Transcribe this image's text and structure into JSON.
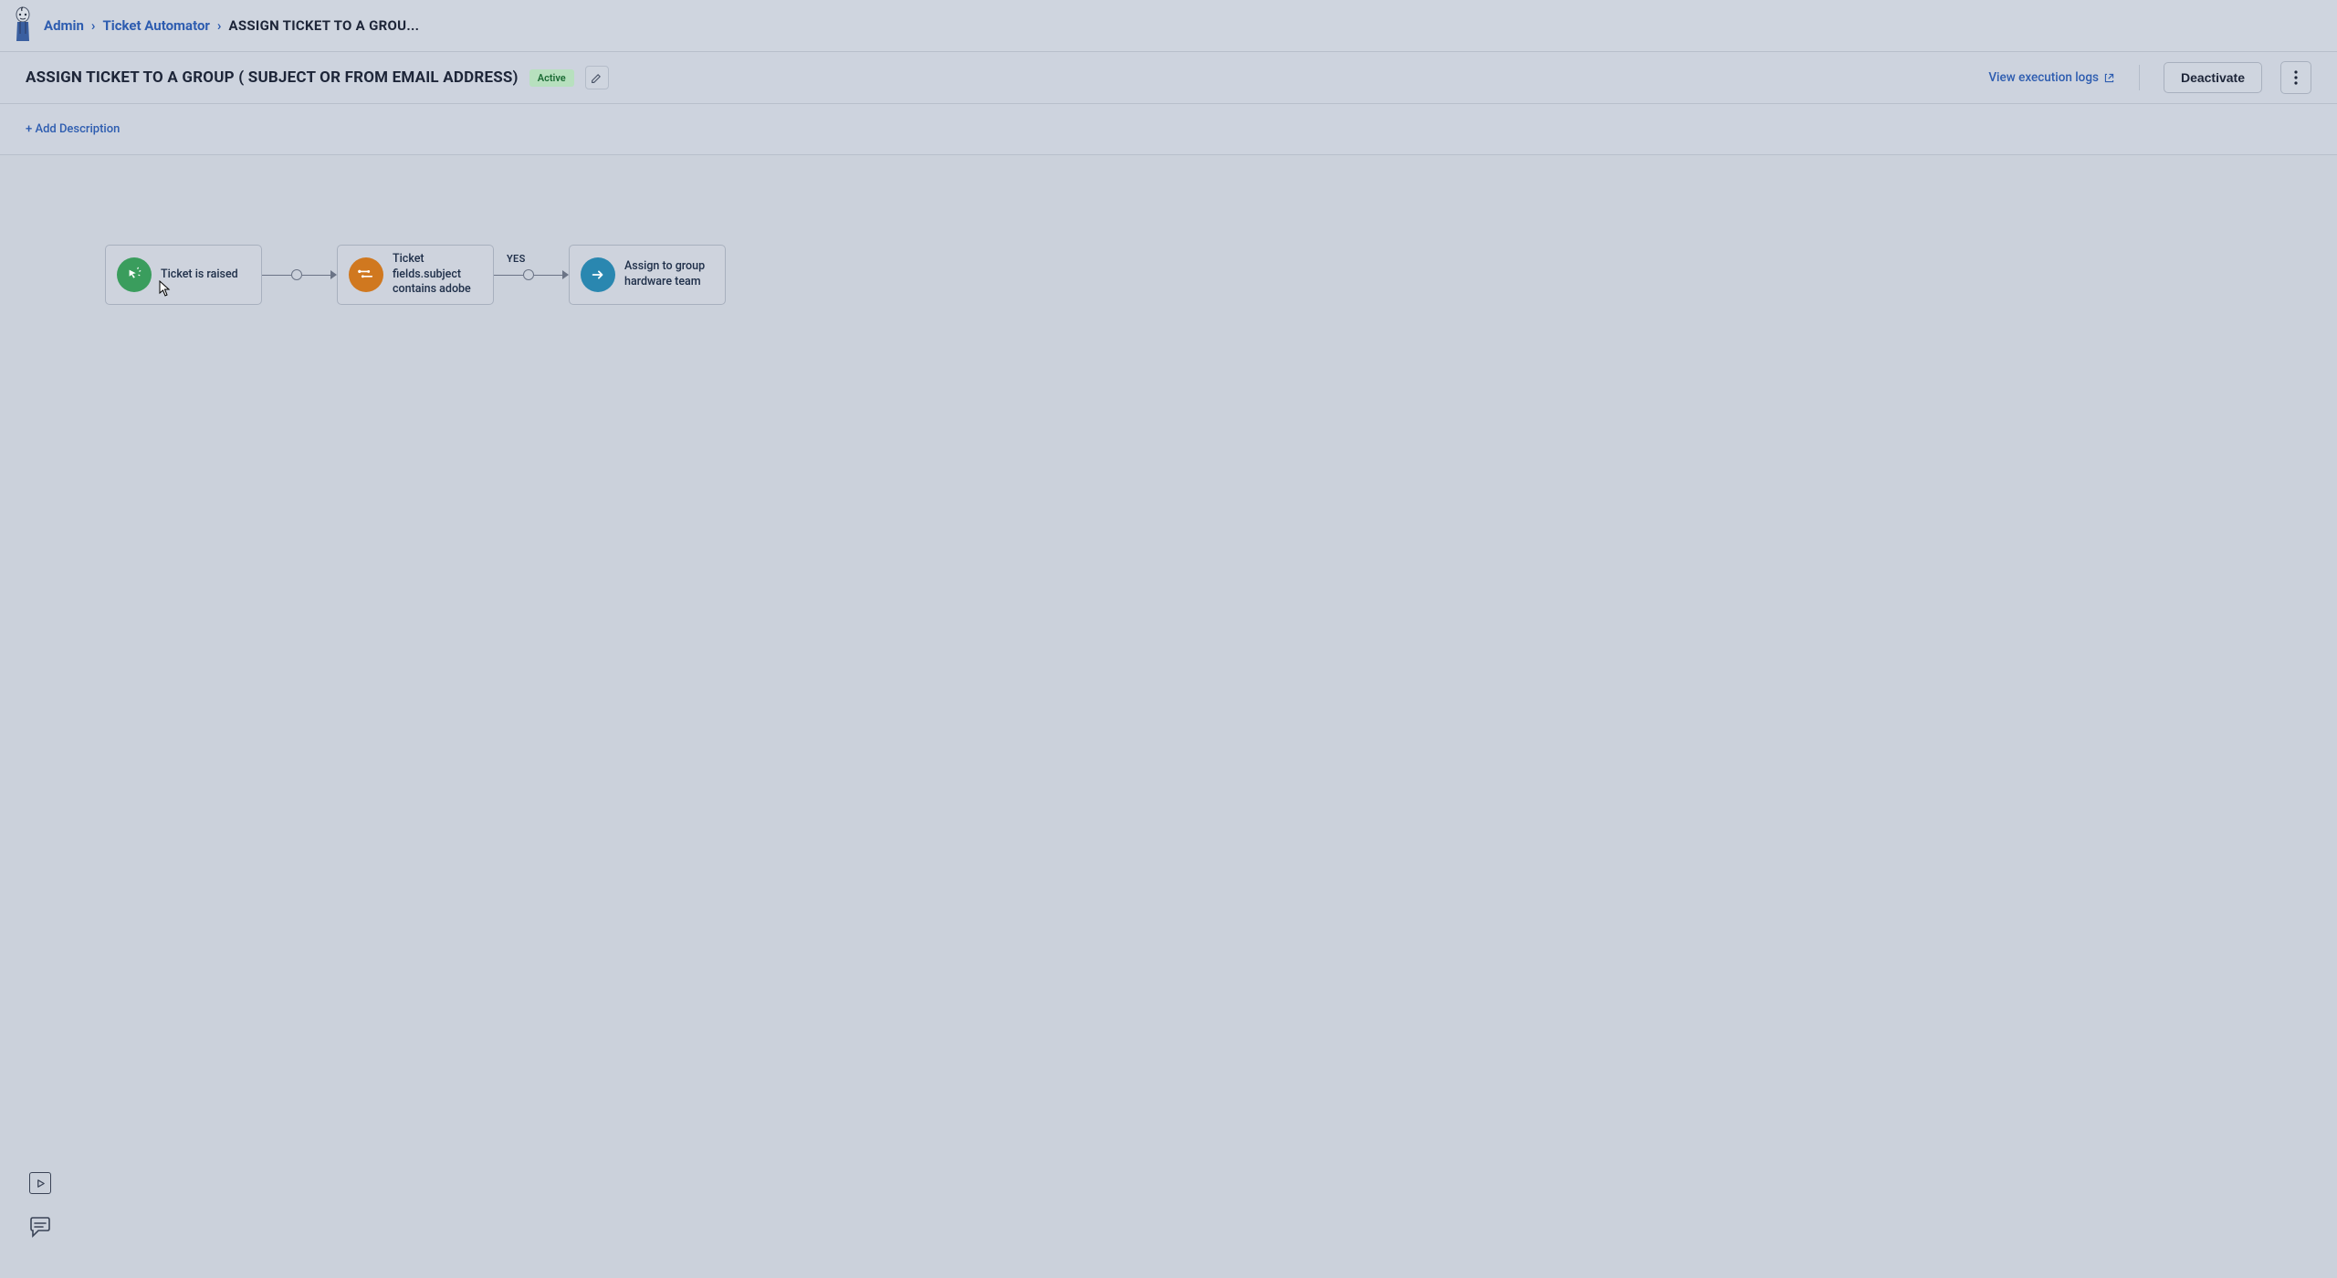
{
  "breadcrumb": {
    "items": [
      "Admin",
      "Ticket Automator"
    ],
    "current": "ASSIGN TICKET TO A GROU..."
  },
  "header": {
    "title": "ASSIGN TICKET TO A GROUP ( SUBJECT OR FROM EMAIL ADDRESS)",
    "status": "Active",
    "logs_link": "View execution logs",
    "deactivate_label": "Deactivate"
  },
  "description": {
    "add_label": "+ Add Description"
  },
  "workflow": {
    "nodes": [
      {
        "label": "Ticket is raised",
        "icon_color": "green",
        "icon": "cursor-click"
      },
      {
        "label": "Ticket fields.subject contains adobe",
        "icon_color": "orange",
        "icon": "filter"
      },
      {
        "label": "Assign to group hardware team",
        "icon_color": "teal",
        "icon": "arrow-right"
      }
    ],
    "edge_labels": [
      "",
      "YES"
    ]
  }
}
